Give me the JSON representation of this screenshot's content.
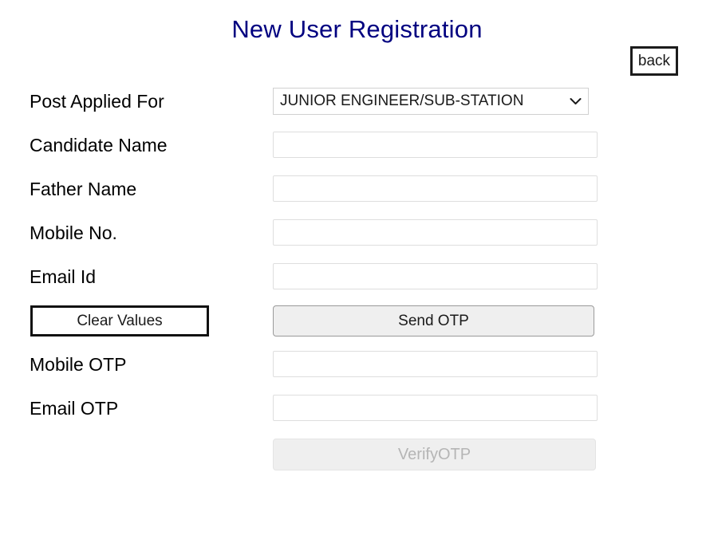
{
  "header": {
    "title": "New User Registration",
    "title_color": "#000080",
    "back_label": "back"
  },
  "form": {
    "fields": [
      {
        "label": "Post Applied For",
        "type": "select",
        "value": "JUNIOR ENGINEER/SUB-STATION",
        "placeholder": ""
      },
      {
        "label": "Candidate Name",
        "type": "text",
        "value": "",
        "placeholder": ""
      },
      {
        "label": "Father Name",
        "type": "text",
        "value": "",
        "placeholder": ""
      },
      {
        "label": "Mobile No.",
        "type": "text",
        "value": "",
        "placeholder": ""
      },
      {
        "label": "Email Id",
        "type": "text",
        "value": "",
        "placeholder": ""
      }
    ],
    "otp_fields": [
      {
        "label": "Mobile OTP",
        "type": "text",
        "value": "",
        "placeholder": ""
      },
      {
        "label": "Email OTP",
        "type": "text",
        "value": "",
        "placeholder": ""
      }
    ],
    "post_options": [
      "JUNIOR ENGINEER/SUB-STATION"
    ]
  },
  "actions": {
    "clear_label": "Clear Values",
    "send_otp_label": "Send OTP",
    "verify_otp_label": "VerifyOTP",
    "verify_otp_disabled": true
  },
  "icons": {
    "chevron_down": "chevron-down-icon"
  }
}
